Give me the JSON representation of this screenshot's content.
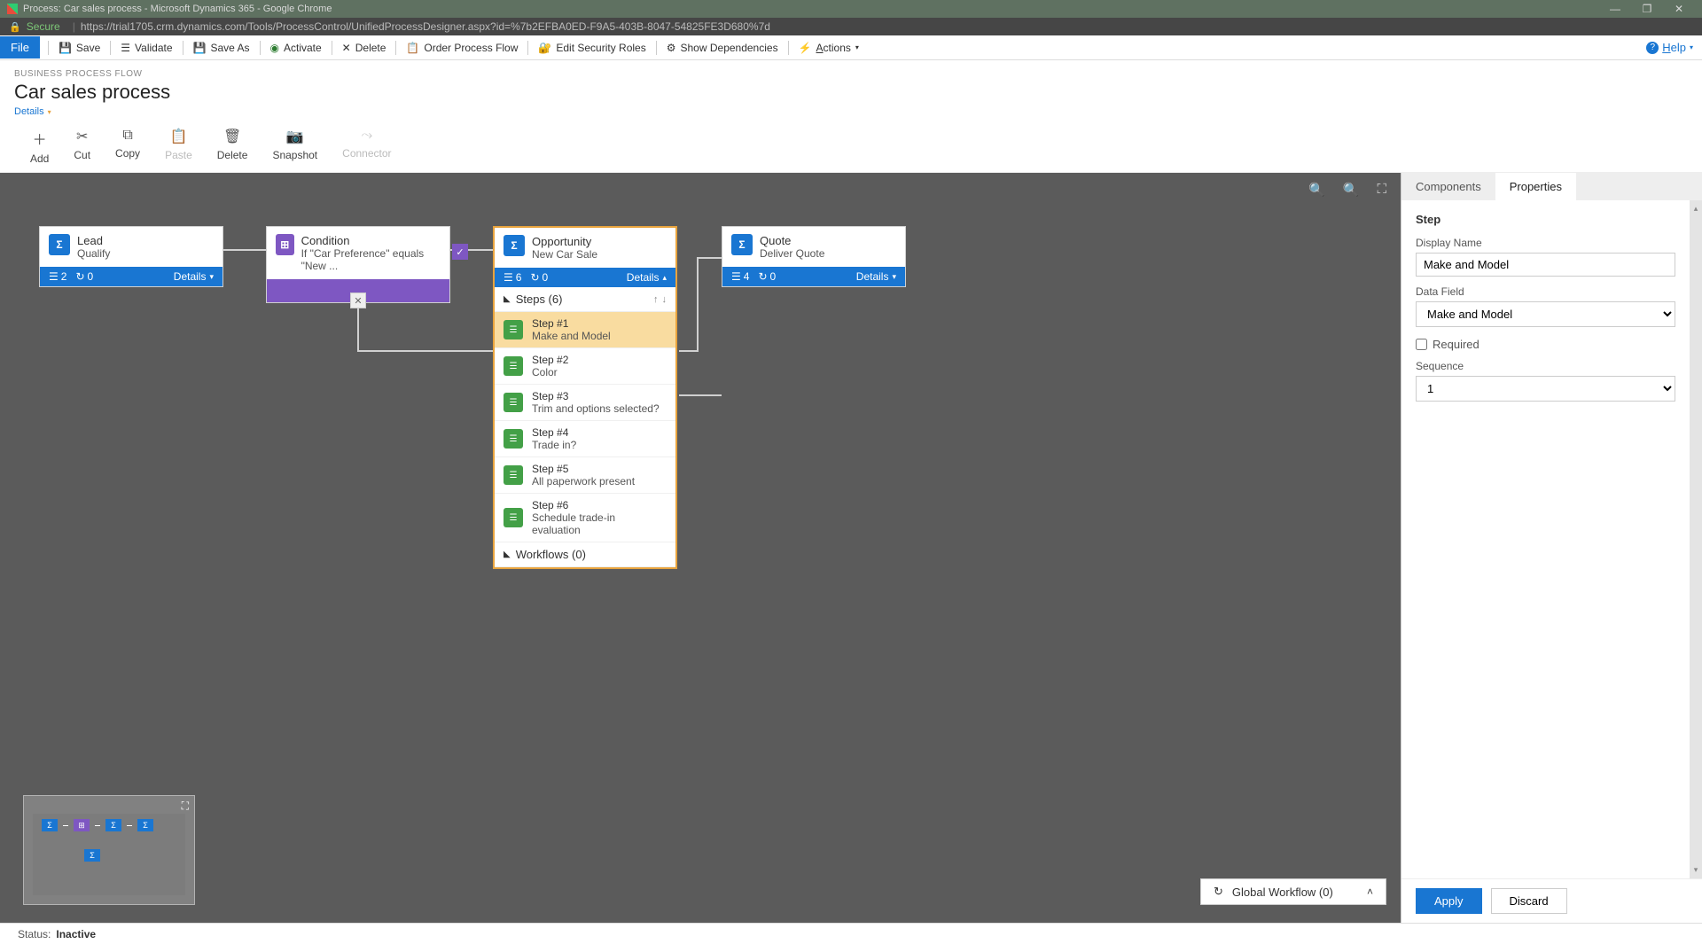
{
  "window": {
    "title": "Process: Car sales process - Microsoft Dynamics 365 - Google Chrome"
  },
  "address": {
    "secure": "Secure",
    "url": "https://trial1705.crm.dynamics.com/Tools/ProcessControl/UnifiedProcessDesigner.aspx?id=%7b2EFBA0ED-F9A5-403B-8047-54825FE3D680%7d"
  },
  "cmdbar": {
    "file": "File",
    "save": "Save",
    "validate": "Validate",
    "saveas": "Save As",
    "activate": "Activate",
    "delete": "Delete",
    "order": "Order Process Flow",
    "editsec": "Edit Security Roles",
    "showdep": "Show Dependencies",
    "actions": "Actions",
    "help": "Help"
  },
  "header": {
    "crumb": "BUSINESS PROCESS FLOW",
    "title": "Car sales process",
    "details": "Details"
  },
  "toolbar": {
    "add": "Add",
    "cut": "Cut",
    "copy": "Copy",
    "paste": "Paste",
    "delete": "Delete",
    "snapshot": "Snapshot",
    "connector": "Connector"
  },
  "nodes": {
    "lead": {
      "title": "Lead",
      "sub": "Qualify",
      "c1": "2",
      "c2": "0",
      "details": "Details"
    },
    "cond": {
      "title": "Condition",
      "sub": "If \"Car Preference\" equals \"New ..."
    },
    "opp": {
      "title": "Opportunity",
      "sub": "New Car Sale",
      "c1": "6",
      "c2": "0",
      "details": "Details",
      "stepsHeader": "Steps (6)",
      "steps": [
        {
          "n": "Step #1",
          "t": "Make and Model"
        },
        {
          "n": "Step #2",
          "t": "Color"
        },
        {
          "n": "Step #3",
          "t": "Trim and options selected?"
        },
        {
          "n": "Step #4",
          "t": "Trade in?"
        },
        {
          "n": "Step #5",
          "t": "All paperwork present"
        },
        {
          "n": "Step #6",
          "t": "Schedule trade-in evaluation"
        }
      ],
      "workflows": "Workflows (0)"
    },
    "quote": {
      "title": "Quote",
      "sub": "Deliver Quote",
      "c1": "4",
      "c2": "0",
      "details": "Details"
    }
  },
  "globalwf": "Global Workflow (0)",
  "side": {
    "tabs": {
      "components": "Components",
      "properties": "Properties"
    },
    "section": "Step",
    "displayNameLabel": "Display Name",
    "displayNameValue": "Make and Model",
    "dataFieldLabel": "Data Field",
    "dataFieldValue": "Make and Model",
    "requiredLabel": "Required",
    "sequenceLabel": "Sequence",
    "sequenceValue": "1",
    "apply": "Apply",
    "discard": "Discard"
  },
  "status": {
    "label": "Status:",
    "value": "Inactive"
  }
}
